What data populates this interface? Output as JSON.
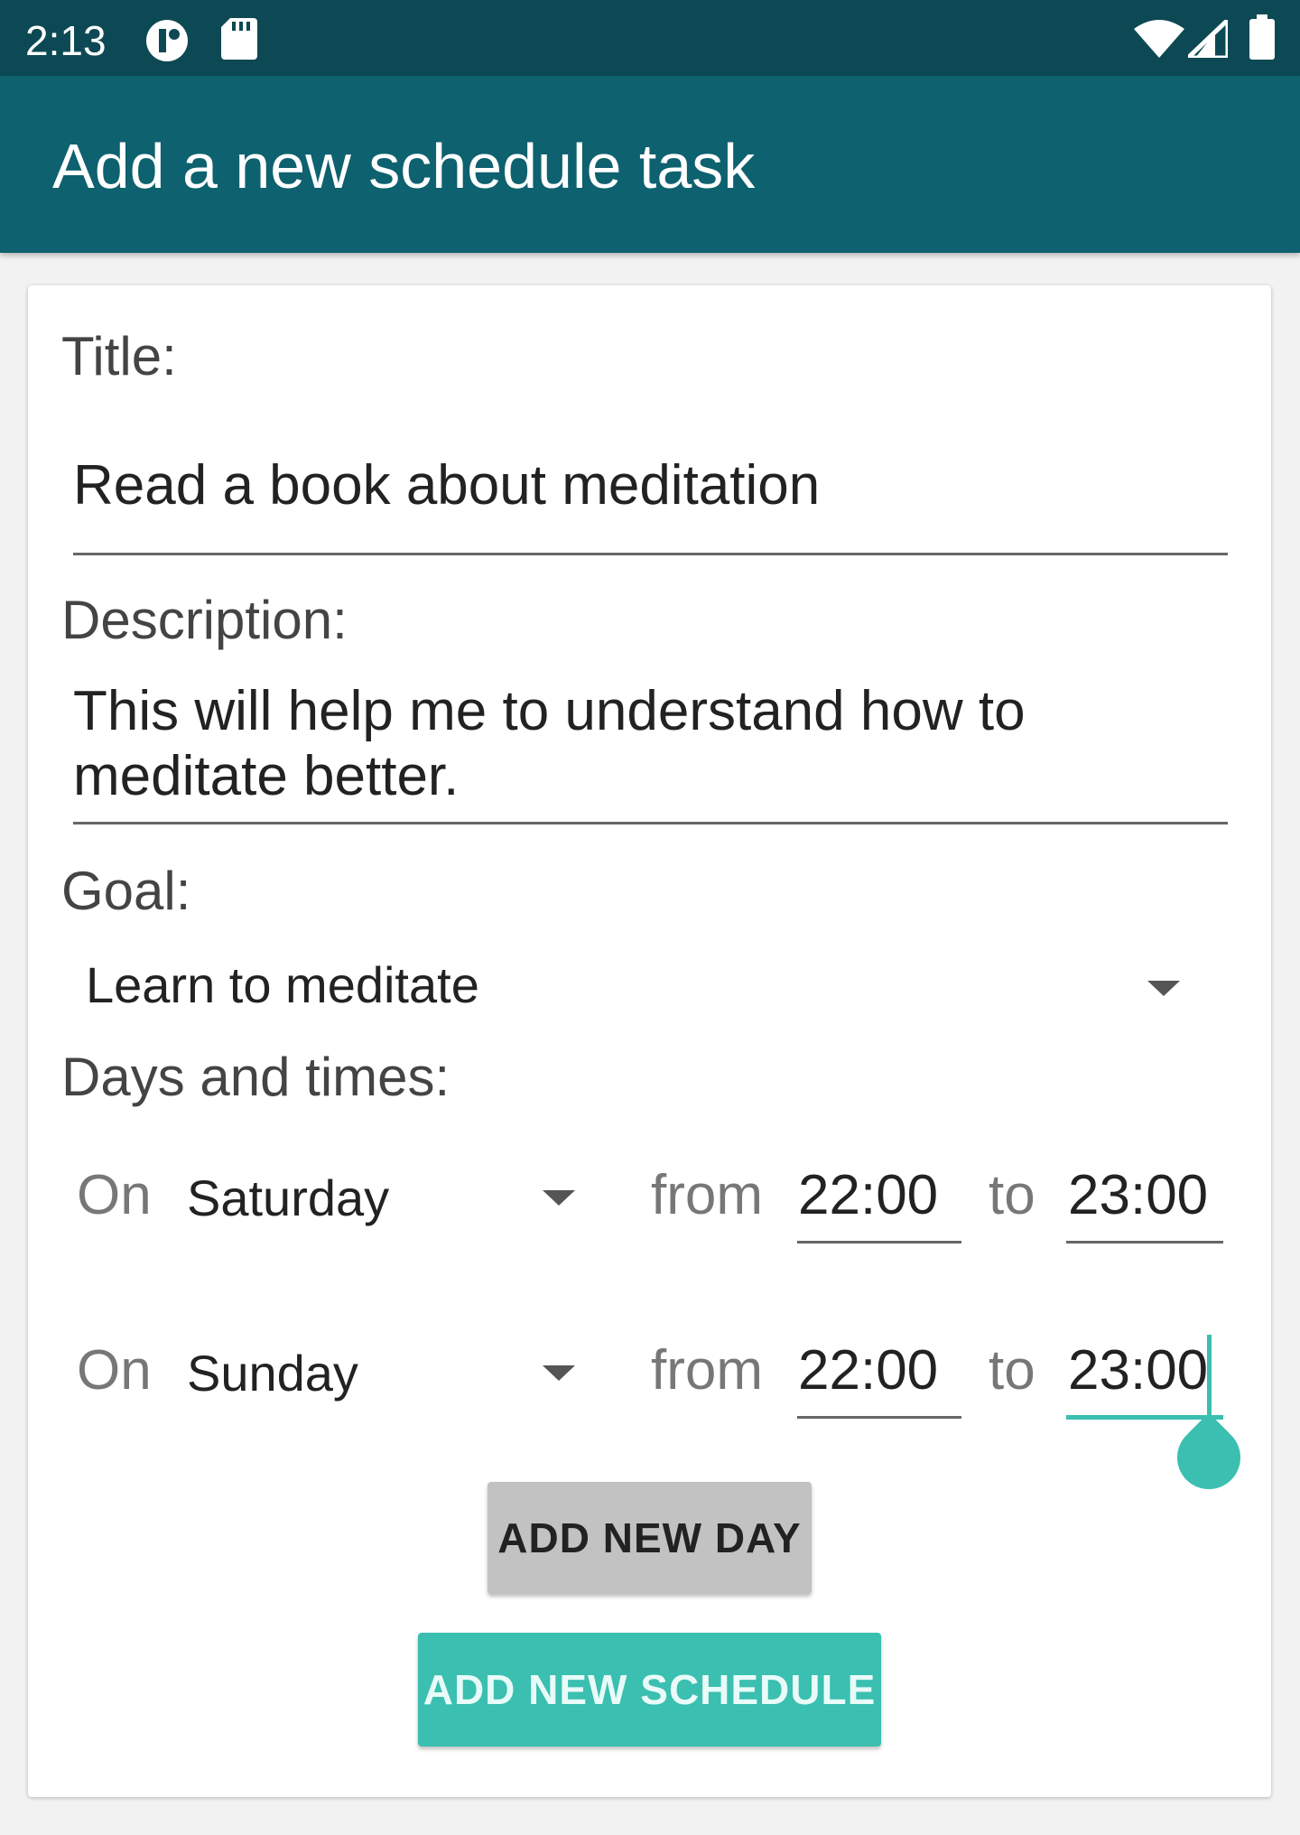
{
  "status_bar": {
    "time": "2:13"
  },
  "app_bar": {
    "title": "Add a new schedule task"
  },
  "form": {
    "title_label": "Title:",
    "title_value": "Read a book about meditation",
    "description_label": "Description:",
    "description_value": "This will help me to understand how to meditate better.",
    "goal_label": "Goal:",
    "goal_value": "Learn to meditate",
    "days_label": "Days and times:",
    "rows": [
      {
        "on": "On",
        "day": "Saturday",
        "from": "from",
        "start": "22:00",
        "to": "to",
        "end": "23:00"
      },
      {
        "on": "On",
        "day": "Sunday",
        "from": "from",
        "start": "22:00",
        "to": "to",
        "end": "23:00"
      }
    ],
    "add_day_button": "ADD NEW DAY",
    "add_schedule_button": "ADD NEW SCHEDULE"
  },
  "colors": {
    "status_bar": "#0d4954",
    "app_bar": "#0e616f",
    "accent": "#3abfb0"
  }
}
